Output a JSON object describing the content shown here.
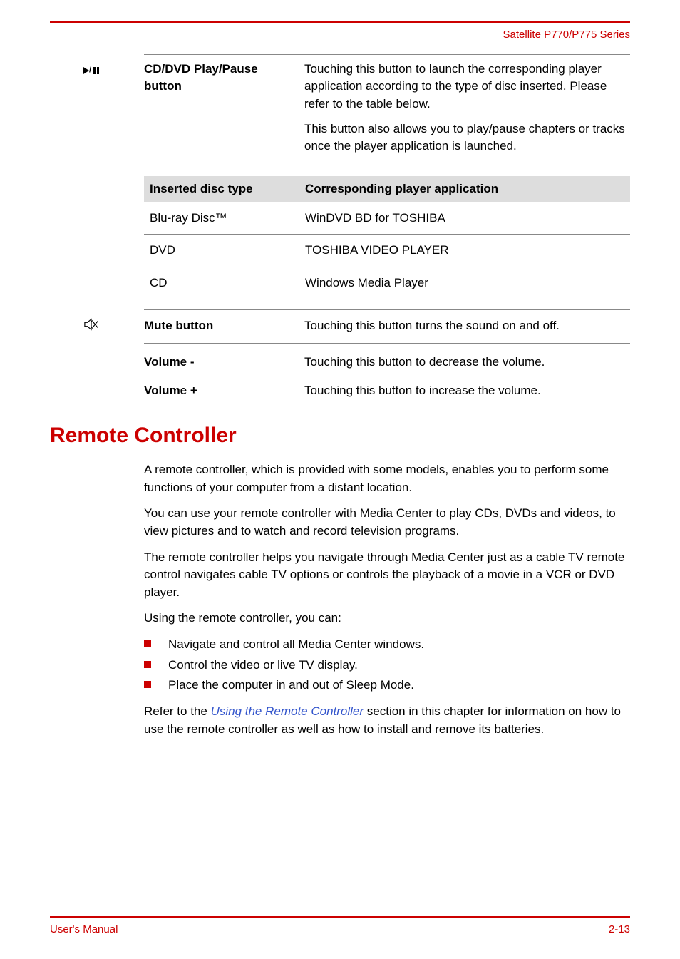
{
  "header": {
    "series": "Satellite P770/P775 Series"
  },
  "playPause": {
    "label": "CD/DVD Play/Pause button",
    "desc1": "Touching this button to launch the corresponding player application according to the type of disc inserted. Please refer to the table below.",
    "desc2": "This button also allows you to play/pause chapters or tracks once the player application is launched."
  },
  "discTable": {
    "header1": "Inserted disc type",
    "header2": "Corresponding player application",
    "rows": [
      {
        "type": "Blu-ray Disc™",
        "app": "WinDVD BD for TOSHIBA"
      },
      {
        "type": "DVD",
        "app": "TOSHIBA VIDEO PLAYER"
      },
      {
        "type": "CD",
        "app": "Windows Media Player"
      }
    ]
  },
  "mute": {
    "label": "Mute button",
    "desc": "Touching this button turns the sound on and off."
  },
  "volDown": {
    "label": "Volume -",
    "desc": "Touching this button to decrease the volume."
  },
  "volUp": {
    "label": "Volume +",
    "desc": "Touching this button to increase the volume."
  },
  "remote": {
    "heading": "Remote Controller",
    "p1": "A remote controller, which is provided with some models, enables you to perform some functions of your computer from a distant location.",
    "p2": "You can use your remote controller with Media Center to play CDs, DVDs and videos, to view pictures and to watch and record television programs.",
    "p3": "The remote controller helps you navigate through Media Center just as a cable TV remote control navigates cable TV options or controls the playback of a movie in a VCR or DVD player.",
    "p4": "Using the remote controller, you can:",
    "bullets": [
      "Navigate and control all Media Center windows.",
      "Control the video or live TV display.",
      "Place the computer in and out of Sleep Mode."
    ],
    "p5_pre": "Refer to the ",
    "p5_link": "Using the Remote Controller",
    "p5_post": " section in this chapter for information on how to use the remote controller as well as how to install and remove its batteries."
  },
  "footer": {
    "left": "User's Manual",
    "right": "2-13"
  }
}
